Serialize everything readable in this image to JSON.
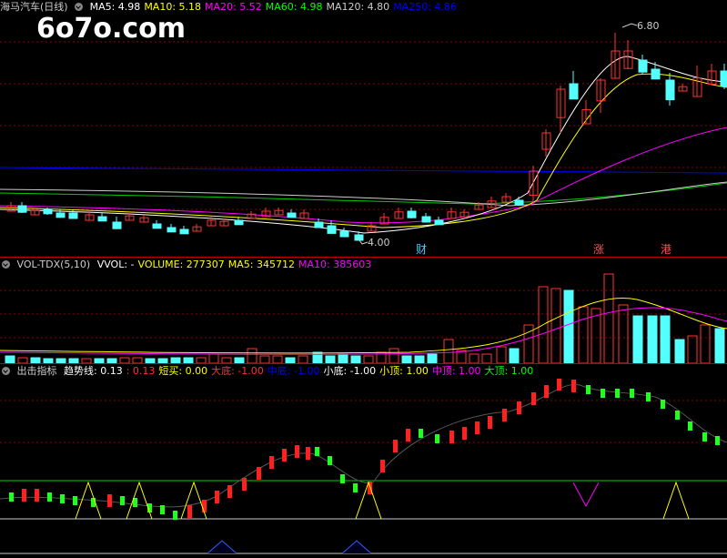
{
  "price_panel": {
    "stock_name": "海马汽车(日线)",
    "ma_labels": [
      {
        "text": "MA5: 4.98",
        "color": "#ffffff"
      },
      {
        "text": "MA10: 5.18",
        "color": "#ffff00"
      },
      {
        "text": "MA20: 5.52",
        "color": "#ff00ff"
      },
      {
        "text": "MA60: 4.98",
        "color": "#00ff00"
      },
      {
        "text": "MA120: 4.80",
        "color": "#cccccc"
      },
      {
        "text": "MA250: 4.86",
        "color": "#0000ff"
      }
    ],
    "high_label": "6.80",
    "low_label": "4.00",
    "event_markers": [
      "财",
      "涨",
      "港"
    ],
    "colors": {
      "up": "#ff3232",
      "down": "#54ffff"
    }
  },
  "watermark": "6o7o.com",
  "volume_panel": {
    "title": "VOL-TDX(5,10)",
    "labels": [
      {
        "text": "VVOL: -",
        "color": "#ffffff"
      },
      {
        "text": "VOLUME: 277307",
        "color": "#ffff00"
      },
      {
        "text": "MA5: 345712",
        "color": "#ffff00"
      },
      {
        "text": "MA10: 385603",
        "color": "#ff00ff"
      }
    ]
  },
  "indicator_panel": {
    "title": "出击指标",
    "labels": [
      {
        "text": "趋势线: 0.13",
        "color": "#ffffff"
      },
      {
        "text": ": 0.13",
        "color": "#ff3232"
      },
      {
        "text": "短买: 0.00",
        "color": "#ffff00"
      },
      {
        "text": "大底: -1.00",
        "color": "#ff3232"
      },
      {
        "text": "中底: -1.00",
        "color": "#0000ff"
      },
      {
        "text": "小底: -1.00",
        "color": "#ffffff"
      },
      {
        "text": "小顶: 1.00",
        "color": "#ffff00"
      },
      {
        "text": "中顶: 1.00",
        "color": "#ff00ff"
      },
      {
        "text": "大顶: 1.00",
        "color": "#00ff00"
      }
    ]
  }
}
